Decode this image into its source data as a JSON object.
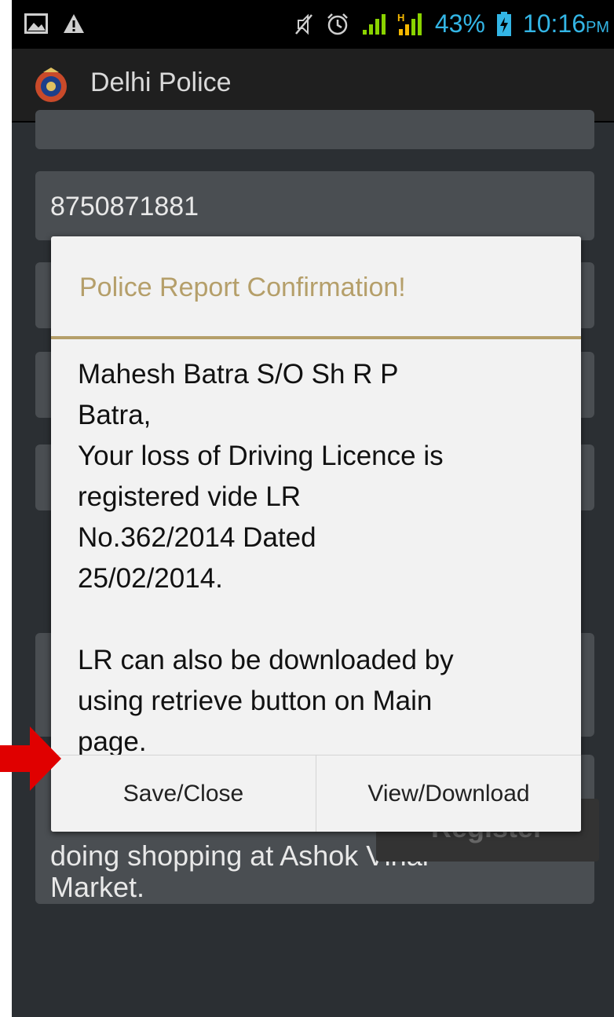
{
  "status_bar": {
    "battery": "43%",
    "time": "10:16",
    "ampm": "PM"
  },
  "action_bar": {
    "title": "Delhi Police"
  },
  "form": {
    "phone_value": "8750871881",
    "description_tail_line1": "doing shopping at Ashok Vihar",
    "description_tail_line2": "Market.",
    "register_label": "Register"
  },
  "dialog": {
    "title": "Police Report Confirmation!",
    "message": "Mahesh Batra S/O Sh R P\nBatra,\nYour loss of Driving Licence is\nregistered vide LR\nNo.362/2014 Dated\n25/02/2014.\n\nLR can also be downloaded by\nusing retrieve button on Main\npage.",
    "buttons": {
      "save_close": "Save/Close",
      "view_download": "View/Download"
    }
  },
  "colors": {
    "accent_gold": "#b59f6a",
    "status_blue": "#33b5e5",
    "annotation_red": "#e00000"
  },
  "icons": [
    "image-icon",
    "warning-icon",
    "mute-icon",
    "alarm-icon",
    "signal-icon",
    "hspa-signal-icon",
    "battery-charging-icon",
    "delhi-police-logo",
    "red-arrow-annotation"
  ]
}
